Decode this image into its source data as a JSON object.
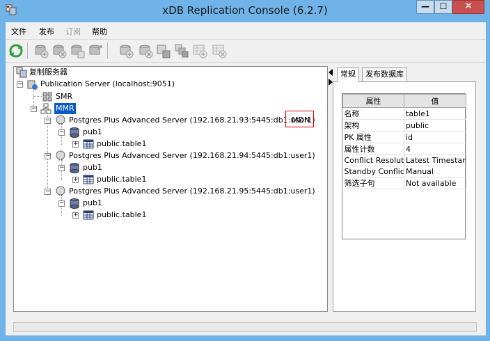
{
  "window": {
    "title": "xDB Replication Console (6.2.7)",
    "min_glyph": "—",
    "max_glyph": "☐",
    "close_glyph": "✕"
  },
  "menu": {
    "items": [
      {
        "label": "文件",
        "enabled": true
      },
      {
        "label": "发布",
        "enabled": true
      },
      {
        "label": "订阅",
        "enabled": false
      },
      {
        "label": "帮助",
        "enabled": true
      }
    ]
  },
  "toolbar": {
    "buttons": [
      "refresh-icon",
      "add-publication-server-icon",
      "remove-publication-server-icon",
      "update-publication-icon",
      "snapshot-icon",
      "add-subscription-server-icon",
      "remove-subscription-server-icon",
      "schedule-icon",
      "sync-icon",
      "add-subscription-icon",
      "remove-subscription-icon"
    ]
  },
  "tree": {
    "root": "复制服务器",
    "publication_server": "Publication Server (localhost:9051)",
    "smr": "SMR",
    "mmr": "MMR",
    "mdn_label": "MDN",
    "nodes": [
      {
        "server": "Postgres Plus Advanced Server (192.168.21.93:5445:db1:user1)",
        "pub": "pub1",
        "table": "public.table1"
      },
      {
        "server": "Postgres Plus Advanced Server (192.168.21.94:5445:db1:user1)",
        "pub": "pub1",
        "table": "public.table1"
      },
      {
        "server": "Postgres Plus Advanced Server (192.168.21.95:5445:db1:user1)",
        "pub": "pub1",
        "table": "public.table1"
      }
    ]
  },
  "tabs": {
    "general": "常规",
    "pub_db": "发布数据库"
  },
  "properties": {
    "headers": {
      "name": "属性",
      "value": "值"
    },
    "rows": [
      {
        "name": "名称",
        "value": "table1"
      },
      {
        "name": "架构",
        "value": "public"
      },
      {
        "name": "PK 属性",
        "value": "id"
      },
      {
        "name": "属性计数",
        "value": "4"
      },
      {
        "name": "Conflict Resolut...",
        "value": "Latest Timestamp"
      },
      {
        "name": "Standby Conflic...",
        "value": "Manual"
      },
      {
        "name": "筛选子句",
        "value": "Not available"
      }
    ]
  },
  "colors": {
    "title_bg": "#6fb3e8",
    "selection": "#0a5bc4",
    "highlight_box": "#e00000",
    "close_btn": "#c75050"
  }
}
